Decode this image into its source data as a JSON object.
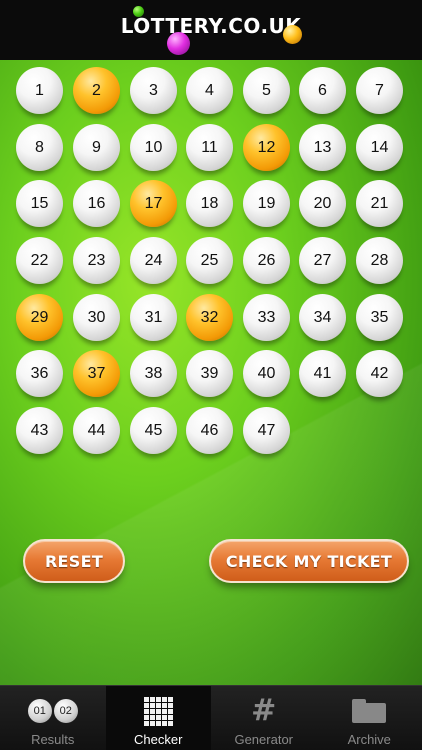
{
  "header": {
    "logo_text": "LOTTERY.CO.UK"
  },
  "numbers": [
    1,
    2,
    3,
    4,
    5,
    6,
    7,
    8,
    9,
    10,
    11,
    12,
    13,
    14,
    15,
    16,
    17,
    18,
    19,
    20,
    21,
    22,
    23,
    24,
    25,
    26,
    27,
    28,
    29,
    30,
    31,
    32,
    33,
    34,
    35,
    36,
    37,
    38,
    39,
    40,
    41,
    42,
    43,
    44,
    45,
    46,
    47
  ],
  "selected_numbers": [
    2,
    12,
    17,
    29,
    32,
    37
  ],
  "buttons": {
    "reset": "RESET",
    "check": "CHECK MY TICKET"
  },
  "tabs": [
    {
      "label": "Results",
      "icon": "results-balls-icon",
      "badges": [
        "01",
        "02"
      ]
    },
    {
      "label": "Checker",
      "icon": "grid-icon",
      "active": true
    },
    {
      "label": "Generator",
      "icon": "hash-icon",
      "glyph": "#"
    },
    {
      "label": "Archive",
      "icon": "folder-icon"
    }
  ],
  "colors": {
    "selected_ball": "#f5a20c",
    "background_green": "#6ccf1e",
    "button_orange": "#e77a35"
  }
}
